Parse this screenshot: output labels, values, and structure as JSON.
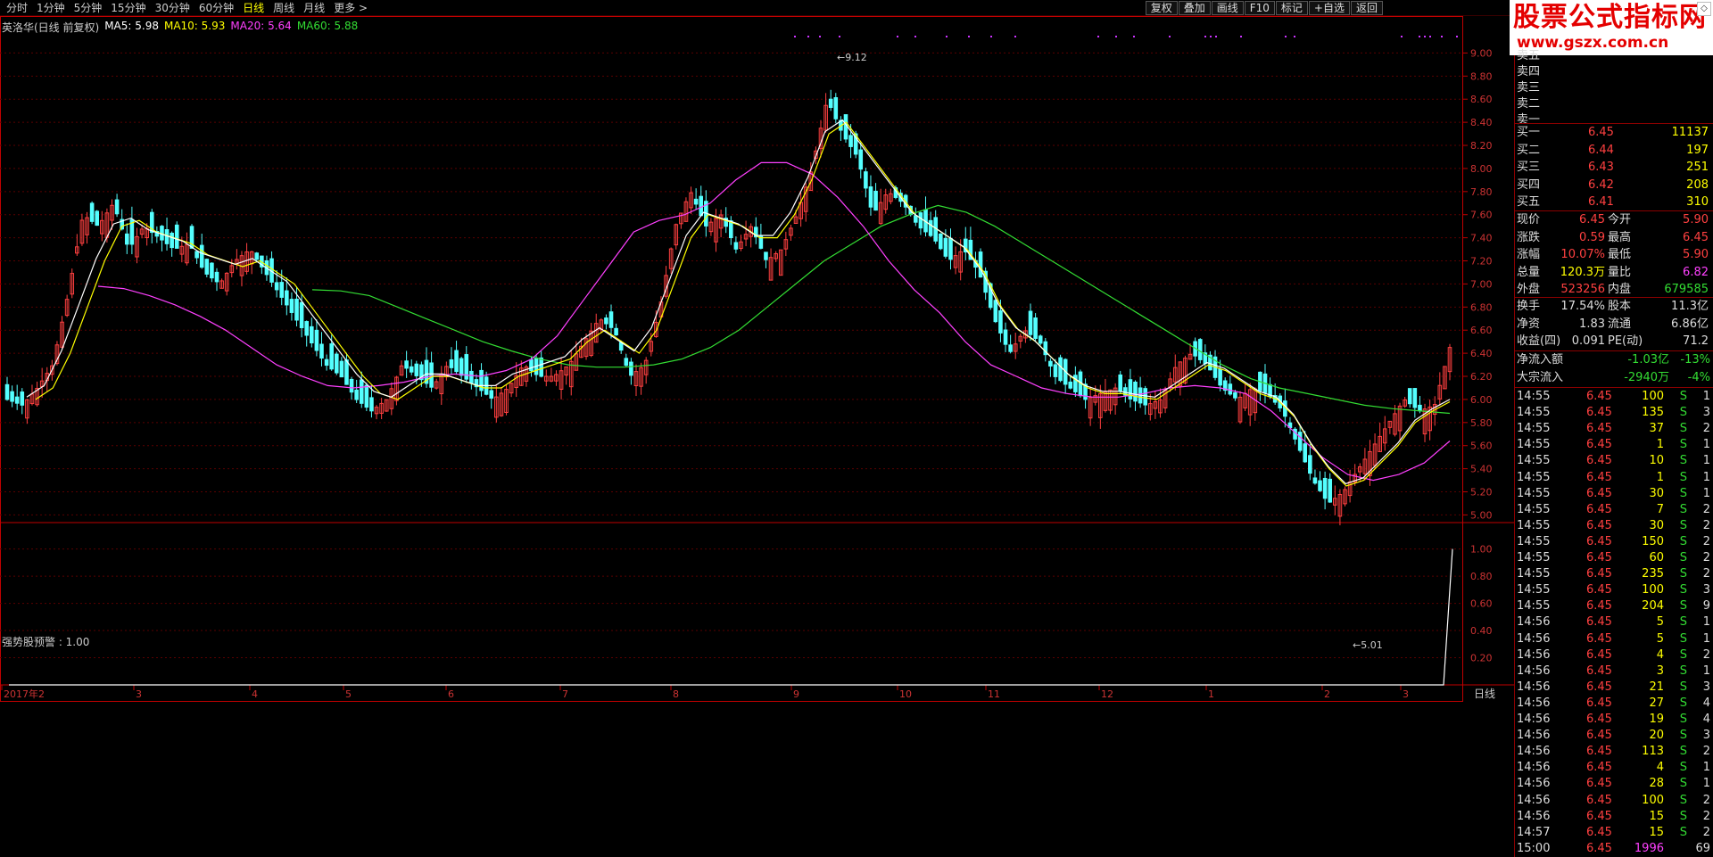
{
  "toolbar": {
    "periods": [
      "分时",
      "1分钟",
      "5分钟",
      "15分钟",
      "30分钟",
      "60分钟",
      "日线",
      "周线",
      "月线",
      "更多 >"
    ],
    "active_period": "日线",
    "tools": [
      "复权",
      "叠加",
      "画线",
      "F10",
      "标记",
      "+自选",
      "返回"
    ]
  },
  "logo": {
    "title": "股票公式指标网",
    "url": "www.gszx.com.cn"
  },
  "colors": {
    "up": "#ff4040",
    "down": "#54ffff",
    "ma5": "#ffffff",
    "ma10": "#ffff00",
    "ma20": "#ff40ff",
    "ma60": "#33dd33",
    "grid": "#5a0000",
    "axis": "#c00000"
  },
  "main_legend": {
    "title": "英洛华(日线 前复权)",
    "ma5": "MA5: 5.98",
    "ma10": "MA10: 5.93",
    "ma20": "MA20: 5.64",
    "ma60": "MA60: 5.88"
  },
  "indicator_legend": "强势股预警 : 1.00",
  "period_label": "日线",
  "chart_data": {
    "type": "candlestick",
    "y_axis_main": {
      "ticks": [
        "9.00",
        "8.80",
        "8.60",
        "8.40",
        "8.20",
        "8.00",
        "7.80",
        "7.60",
        "7.40",
        "7.20",
        "7.00",
        "6.80",
        "6.60",
        "6.40",
        "6.20",
        "6.00",
        "5.80",
        "5.60",
        "5.40",
        "5.20",
        "5.00"
      ],
      "ylim": [
        4.98,
        9.15
      ]
    },
    "y_axis_ind": {
      "ticks": [
        "1.00",
        "0.80",
        "0.60",
        "0.40",
        "0.20"
      ],
      "ylim": [
        0,
        1.05
      ]
    },
    "x_axis": {
      "labels": [
        "2017年2",
        "3",
        "4",
        "5",
        "6",
        "7",
        "8",
        "9",
        "10",
        "11",
        "12",
        "1",
        "2",
        "3"
      ]
    },
    "annotations": {
      "high": "9.12",
      "low": "5.01"
    },
    "close_path": [
      6.0,
      5.95,
      6.1,
      6.3,
      6.9,
      7.6,
      7.5,
      7.7,
      7.3,
      7.5,
      7.4,
      7.3,
      7.35,
      7.1,
      7.0,
      7.2,
      7.3,
      7.1,
      6.9,
      6.7,
      6.5,
      6.3,
      6.2,
      6.0,
      5.9,
      6.0,
      6.3,
      6.2,
      6.1,
      6.3,
      6.2,
      6.1,
      6.0,
      6.1,
      6.3,
      6.2,
      6.2,
      6.3,
      6.5,
      6.7,
      6.6,
      6.2,
      6.3,
      6.8,
      7.5,
      7.8,
      7.5,
      7.6,
      7.3,
      7.5,
      7.2,
      7.3,
      7.6,
      8.0,
      8.6,
      8.3,
      8.1,
      7.6,
      7.8,
      7.7,
      7.5,
      7.4,
      7.2,
      7.3,
      7.1,
      6.7,
      6.4,
      6.6,
      6.5,
      6.2,
      6.1,
      6.0,
      6.05,
      6.1,
      6.0,
      5.95,
      6.0,
      6.3,
      6.4,
      6.3,
      6.1,
      6.0,
      6.1,
      6.05,
      5.9,
      5.6,
      5.3,
      5.1,
      5.2,
      5.4,
      5.6,
      5.8,
      6.0,
      5.9,
      5.95,
      6.45
    ],
    "ma5": [
      6.0,
      6.1,
      6.4,
      6.8,
      7.2,
      7.5,
      7.55,
      7.45,
      7.4,
      7.35,
      7.25,
      7.2,
      7.15,
      7.2,
      7.1,
      7.0,
      6.8,
      6.6,
      6.4,
      6.2,
      6.05,
      6.0,
      6.1,
      6.2,
      6.2,
      6.15,
      6.1,
      6.1,
      6.2,
      6.25,
      6.3,
      6.35,
      6.5,
      6.6,
      6.5,
      6.4,
      6.6,
      7.0,
      7.4,
      7.6,
      7.55,
      7.5,
      7.4,
      7.4,
      7.6,
      7.9,
      8.3,
      8.4,
      8.2,
      8.0,
      7.8,
      7.6,
      7.5,
      7.4,
      7.3,
      7.1,
      6.8,
      6.6,
      6.5,
      6.35,
      6.2,
      6.1,
      6.05,
      6.05,
      6.02,
      6.0,
      6.1,
      6.2,
      6.3,
      6.25,
      6.15,
      6.05,
      6.0,
      5.85,
      5.6,
      5.4,
      5.25,
      5.3,
      5.45,
      5.6,
      5.8,
      5.9,
      5.98
    ],
    "ma20": [
      6.98,
      6.96,
      6.9,
      6.82,
      6.72,
      6.6,
      6.45,
      6.3,
      6.2,
      6.12,
      6.1,
      6.12,
      6.15,
      6.2,
      6.22,
      6.2,
      6.25,
      6.35,
      6.55,
      6.85,
      7.15,
      7.45,
      7.55,
      7.6,
      7.7,
      7.9,
      8.05,
      8.05,
      7.95,
      7.75,
      7.5,
      7.2,
      6.95,
      6.75,
      6.5,
      6.3,
      6.2,
      6.1,
      6.05,
      6.02,
      6.02,
      6.05,
      6.1,
      6.12,
      6.1,
      6.05,
      5.9,
      5.7,
      5.5,
      5.35,
      5.3,
      5.35,
      5.45,
      5.64
    ],
    "ma60": [
      6.95,
      6.94,
      6.9,
      6.8,
      6.7,
      6.6,
      6.5,
      6.42,
      6.35,
      6.3,
      6.28,
      6.28,
      6.3,
      6.35,
      6.45,
      6.6,
      6.8,
      7.0,
      7.2,
      7.35,
      7.5,
      7.6,
      7.68,
      7.62,
      7.5,
      7.35,
      7.2,
      7.05,
      6.9,
      6.75,
      6.6,
      6.45,
      6.3,
      6.18,
      6.1,
      6.05,
      6.0,
      5.95,
      5.92,
      5.9,
      5.88
    ],
    "indicator_last": 1.0
  },
  "orderbook": {
    "asks": [
      {
        "label": "卖五",
        "price": "",
        "vol": ""
      },
      {
        "label": "卖四",
        "price": "",
        "vol": ""
      },
      {
        "label": "卖三",
        "price": "",
        "vol": ""
      },
      {
        "label": "卖二",
        "price": "",
        "vol": ""
      },
      {
        "label": "卖一",
        "price": "",
        "vol": ""
      }
    ],
    "bids": [
      {
        "label": "买一",
        "price": "6.45",
        "vol": "11137"
      },
      {
        "label": "买二",
        "price": "6.44",
        "vol": "197"
      },
      {
        "label": "买三",
        "price": "6.43",
        "vol": "251"
      },
      {
        "label": "买四",
        "price": "6.42",
        "vol": "208"
      },
      {
        "label": "买五",
        "price": "6.41",
        "vol": "310"
      }
    ]
  },
  "quote": [
    {
      "l1": "现价",
      "v1": "6.45",
      "c1": "red",
      "l2": "今开",
      "v2": "5.90",
      "c2": "red"
    },
    {
      "l1": "涨跌",
      "v1": "0.59",
      "c1": "red",
      "l2": "最高",
      "v2": "6.45",
      "c2": "red"
    },
    {
      "l1": "涨幅",
      "v1": "10.07%",
      "c1": "red",
      "l2": "最低",
      "v2": "5.90",
      "c2": "red"
    },
    {
      "l1": "总量",
      "v1": "120.3万",
      "c1": "yel",
      "l2": "量比",
      "v2": "6.82",
      "c2": "mag"
    },
    {
      "l1": "外盘",
      "v1": "523256",
      "c1": "red",
      "l2": "内盘",
      "v2": "679585",
      "c2": "grn"
    }
  ],
  "fundamentals": [
    {
      "l1": "换手",
      "v1": "17.54%",
      "l2": "股本",
      "v2": "11.3亿"
    },
    {
      "l1": "净资",
      "v1": "1.83",
      "l2": "流通",
      "v2": "6.86亿"
    },
    {
      "l1": "收益(四)",
      "v1": "0.091",
      "l2": "PE(动)",
      "v2": "71.2"
    }
  ],
  "flows": [
    {
      "label": "净流入额",
      "v1": "-1.03亿",
      "v2": "-13%"
    },
    {
      "label": "大宗流入",
      "v1": "-2940万",
      "v2": "-4%"
    }
  ],
  "ticks": [
    [
      "14:55",
      "6.45",
      "100",
      "S",
      "1"
    ],
    [
      "14:55",
      "6.45",
      "135",
      "S",
      "3"
    ],
    [
      "14:55",
      "6.45",
      "37",
      "S",
      "2"
    ],
    [
      "14:55",
      "6.45",
      "1",
      "S",
      "1"
    ],
    [
      "14:55",
      "6.45",
      "10",
      "S",
      "1"
    ],
    [
      "14:55",
      "6.45",
      "1",
      "S",
      "1"
    ],
    [
      "14:55",
      "6.45",
      "30",
      "S",
      "1"
    ],
    [
      "14:55",
      "6.45",
      "7",
      "S",
      "2"
    ],
    [
      "14:55",
      "6.45",
      "30",
      "S",
      "2"
    ],
    [
      "14:55",
      "6.45",
      "150",
      "S",
      "2"
    ],
    [
      "14:55",
      "6.45",
      "60",
      "S",
      "2"
    ],
    [
      "14:55",
      "6.45",
      "235",
      "S",
      "2"
    ],
    [
      "14:55",
      "6.45",
      "100",
      "S",
      "3"
    ],
    [
      "14:55",
      "6.45",
      "204",
      "S",
      "9"
    ],
    [
      "14:56",
      "6.45",
      "5",
      "S",
      "1"
    ],
    [
      "14:56",
      "6.45",
      "5",
      "S",
      "1"
    ],
    [
      "14:56",
      "6.45",
      "4",
      "S",
      "2"
    ],
    [
      "14:56",
      "6.45",
      "3",
      "S",
      "1"
    ],
    [
      "14:56",
      "6.45",
      "21",
      "S",
      "3"
    ],
    [
      "14:56",
      "6.45",
      "27",
      "S",
      "4"
    ],
    [
      "14:56",
      "6.45",
      "19",
      "S",
      "4"
    ],
    [
      "14:56",
      "6.45",
      "20",
      "S",
      "3"
    ],
    [
      "14:56",
      "6.45",
      "113",
      "S",
      "2"
    ],
    [
      "14:56",
      "6.45",
      "4",
      "S",
      "1"
    ],
    [
      "14:56",
      "6.45",
      "28",
      "S",
      "1"
    ],
    [
      "14:56",
      "6.45",
      "100",
      "S",
      "2"
    ],
    [
      "14:56",
      "6.45",
      "15",
      "S",
      "2"
    ],
    [
      "14:57",
      "6.45",
      "15",
      "S",
      "2"
    ],
    [
      "15:00",
      "6.45",
      "1996",
      "",
      "69"
    ]
  ]
}
